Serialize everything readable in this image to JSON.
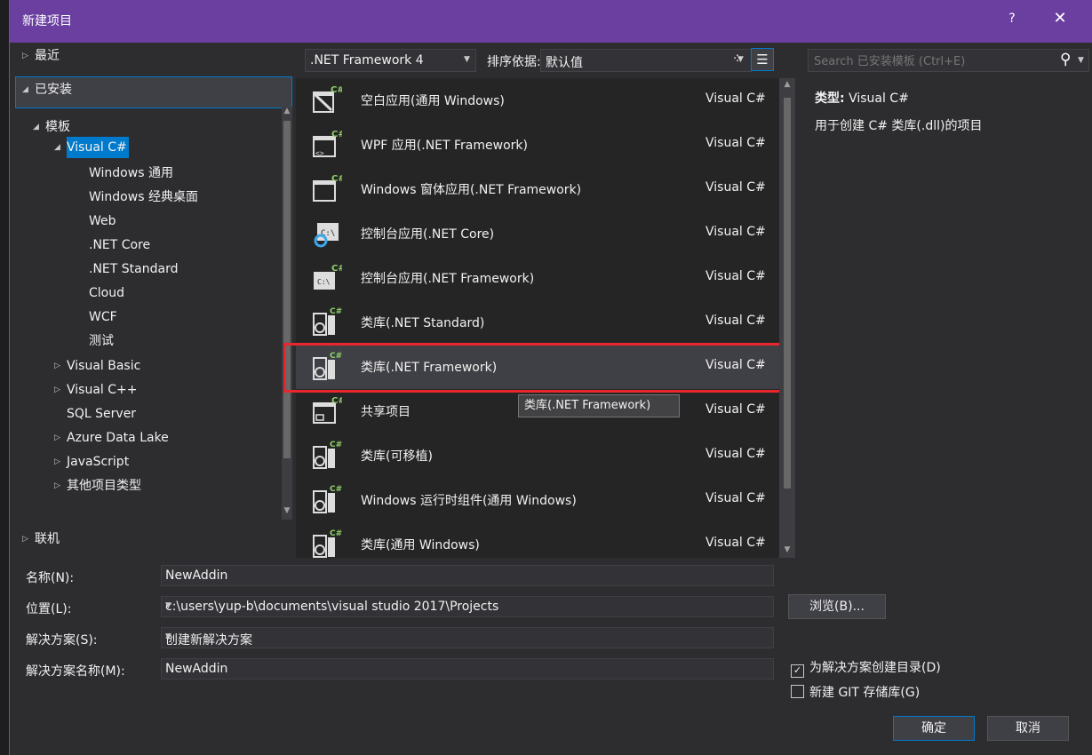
{
  "dialog": {
    "title": "新建项目",
    "help": "?",
    "close": "✕"
  },
  "tree": {
    "recent": "最近",
    "installed": "已安装",
    "templates": "模板",
    "visual_csharp": "Visual C#",
    "csharp_children": [
      "Windows 通用",
      "Windows 经典桌面",
      "Web",
      ".NET Core",
      ".NET Standard",
      "Cloud",
      "WCF",
      "测试"
    ],
    "visual_basic": "Visual Basic",
    "visual_cpp": "Visual C++",
    "sql_server": "SQL Server",
    "azure_data_lake": "Azure Data Lake",
    "javascript": "JavaScript",
    "other_types": "其他项目类型",
    "online": "联机"
  },
  "toolbar": {
    "framework": ".NET Framework 4",
    "sort_label": "排序依据:",
    "sort_value": "默认值",
    "search_placeholder": "Search 已安装模板 (Ctrl+E)"
  },
  "templates": [
    {
      "name": "空白应用(通用 Windows)",
      "lang": "Visual C#",
      "icon": "uwp-app-icon"
    },
    {
      "name": "WPF 应用(.NET Framework)",
      "lang": "Visual C#",
      "icon": "wpf-app-icon"
    },
    {
      "name": "Windows 窗体应用(.NET Framework)",
      "lang": "Visual C#",
      "icon": "winforms-app-icon"
    },
    {
      "name": "控制台应用(.NET Core)",
      "lang": "Visual C#",
      "icon": "console-core-icon"
    },
    {
      "name": "控制台应用(.NET Framework)",
      "lang": "Visual C#",
      "icon": "console-framework-icon"
    },
    {
      "name": "类库(.NET Standard)",
      "lang": "Visual C#",
      "icon": "class-library-icon"
    },
    {
      "name": "类库(.NET Framework)",
      "lang": "Visual C#",
      "icon": "class-library-icon",
      "selected": true
    },
    {
      "name": "共享项目",
      "lang": "Visual C#",
      "icon": "shared-project-icon"
    },
    {
      "name": "类库(可移植)",
      "lang": "Visual C#",
      "icon": "class-library-icon"
    },
    {
      "name": "Windows 运行时组件(通用 Windows)",
      "lang": "Visual C#",
      "icon": "class-library-icon"
    },
    {
      "name": "类库(通用 Windows)",
      "lang": "Visual C#",
      "icon": "class-library-icon"
    }
  ],
  "tooltip": "类库(.NET Framework)",
  "details": {
    "type_label": "类型:",
    "type_value": "Visual C#",
    "description": "用于创建 C# 类库(.dll)的项目"
  },
  "form": {
    "name_label": "名称(N):",
    "name_value": "NewAddin",
    "location_label": "位置(L):",
    "location_value": "c:\\users\\yup-b\\documents\\visual studio 2017\\Projects",
    "solution_label": "解决方案(S):",
    "solution_value": "创建新解决方案",
    "solution_name_label": "解决方案名称(M):",
    "solution_name_value": "NewAddin",
    "browse": "浏览(B)...",
    "create_dir": "为解决方案创建目录(D)",
    "create_dir_checked": true,
    "new_git": "新建 GIT 存储库(G)",
    "new_git_checked": false,
    "ok": "确定",
    "cancel": "取消"
  }
}
